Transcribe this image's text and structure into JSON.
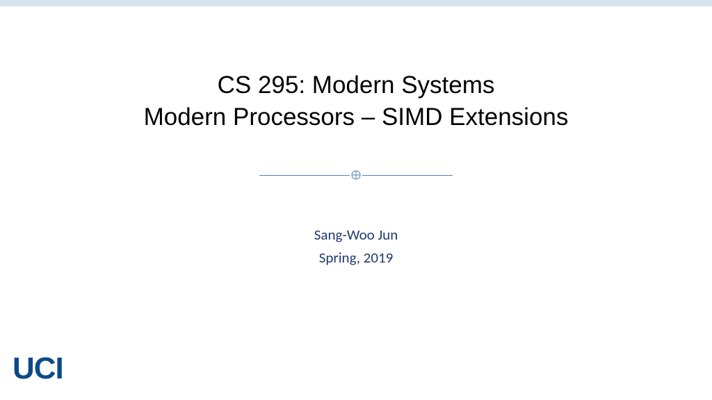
{
  "title": {
    "line1": "CS 295: Modern Systems",
    "line2": "Modern Processors – SIMD Extensions"
  },
  "author": "Sang-Woo Jun",
  "term": "Spring, 2019",
  "logo": "UCI",
  "colors": {
    "topbar": "#d6e4f0",
    "accent": "#4a7fb5",
    "navy": "#1f3a6e",
    "logo": "#0b4a8a"
  }
}
